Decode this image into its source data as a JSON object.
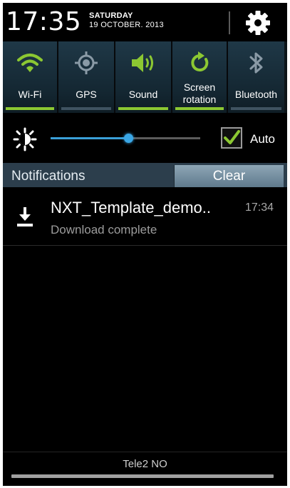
{
  "status": {
    "time": "17:35",
    "day": "SATURDAY",
    "date": "19 OCTOBER. 2013"
  },
  "toggles": [
    {
      "label": "Wi-Fi",
      "icon": "wifi-icon",
      "on": true
    },
    {
      "label": "GPS",
      "icon": "gps-icon",
      "on": false
    },
    {
      "label": "Sound",
      "icon": "sound-icon",
      "on": true
    },
    {
      "label_line1": "Screen",
      "label_line2": "rotation",
      "icon": "rotation-icon",
      "on": true
    },
    {
      "label": "Bluetooth",
      "icon": "bluetooth-icon",
      "on": false
    }
  ],
  "brightness": {
    "level": 0.52,
    "auto_label": "Auto",
    "auto_checked": true
  },
  "notifications": {
    "header": "Notifications",
    "clear_label": "Clear",
    "items": [
      {
        "title": "NXT_Template_demo..",
        "time": "17:34",
        "subtitle": "Download complete",
        "icon": "download-icon"
      }
    ]
  },
  "footer": {
    "carrier": "Tele2 NO"
  },
  "colors": {
    "accent_green": "#8cc832",
    "accent_blue": "#3aa7e6",
    "toggle_bg": "#1f3847"
  }
}
